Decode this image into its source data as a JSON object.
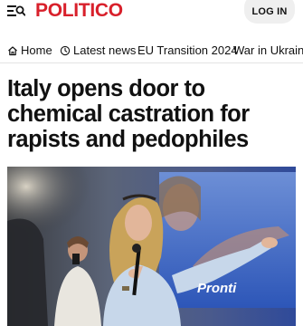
{
  "header": {
    "logo_text": "POLITICO",
    "login_label": "LOG IN",
    "menu_icon": "menu-search-icon"
  },
  "nav": {
    "items": [
      {
        "label": "Home",
        "icon": "home-icon"
      },
      {
        "label": "Latest news",
        "icon": "clock-icon"
      },
      {
        "label": "EU Transition 2024"
      },
      {
        "label": "War in Ukraine"
      }
    ]
  },
  "article": {
    "headline": "Italy opens door to chemical castration for rapists and pedophiles",
    "banner_text": "Pronti"
  },
  "colors": {
    "brand_red": "#d8202b",
    "login_bg": "#efefef"
  }
}
